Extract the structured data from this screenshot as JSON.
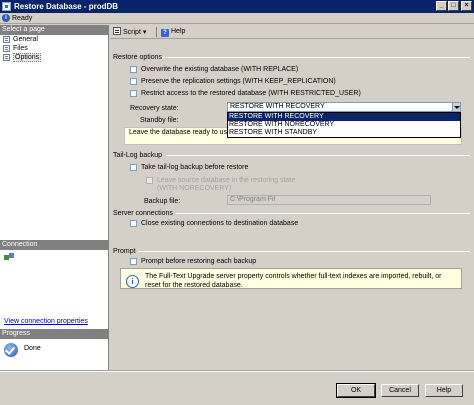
{
  "window": {
    "title": "Restore Database - prodDB"
  },
  "status": {
    "text": "Ready"
  },
  "left_panel": {
    "select_page_header": "Select a page",
    "pages": [
      {
        "label": "General"
      },
      {
        "label": "Files"
      },
      {
        "label": "Options"
      }
    ],
    "connection_header": "Connection",
    "connection_link": "View connection properties",
    "progress_header": "Progress",
    "progress_status": "Done"
  },
  "toolbar": {
    "script_label": "Script",
    "help_label": "Help"
  },
  "restore_options": {
    "title": "Restore options",
    "overwrite": "Overwrite the existing database (WITH REPLACE)",
    "preserve_replication": "Preserve the replication settings (WITH KEEP_REPLICATION)",
    "restrict_access": "Restrict access to the restored database (WITH RESTRICTED_USER)",
    "recovery_state_label": "Recovery state:",
    "recovery_state_value": "RESTORE WITH RECOVERY",
    "recovery_options": [
      "RESTORE WITH RECOVERY",
      "RESTORE WITH NORECOVERY",
      "RESTORE WITH STANDBY"
    ],
    "standby_file_label": "Standby file:",
    "description": "Leave the database ready to use by"
  },
  "tail_log": {
    "title": "Tail-Log backup",
    "take_backup": "Take tail-log backup before restore",
    "leave_source_line1": "Leave source database in the restoring state",
    "leave_source_line2": "(WITH NORECOVERY)",
    "backup_file_label": "Backup file:",
    "backup_file_value": "C:\\Program Fil"
  },
  "server_connections": {
    "title": "Server connections",
    "close_existing": "Close existing connections to destination database"
  },
  "prompt": {
    "title": "Prompt",
    "prompt_before": "Prompt before restoring each backup",
    "info_text": "The Full-Text Upgrade server property controls whether full-text indexes are imported, rebuilt, or reset for the restored database."
  },
  "buttons": {
    "ok": "OK",
    "cancel": "Cancel",
    "help": "Help"
  }
}
